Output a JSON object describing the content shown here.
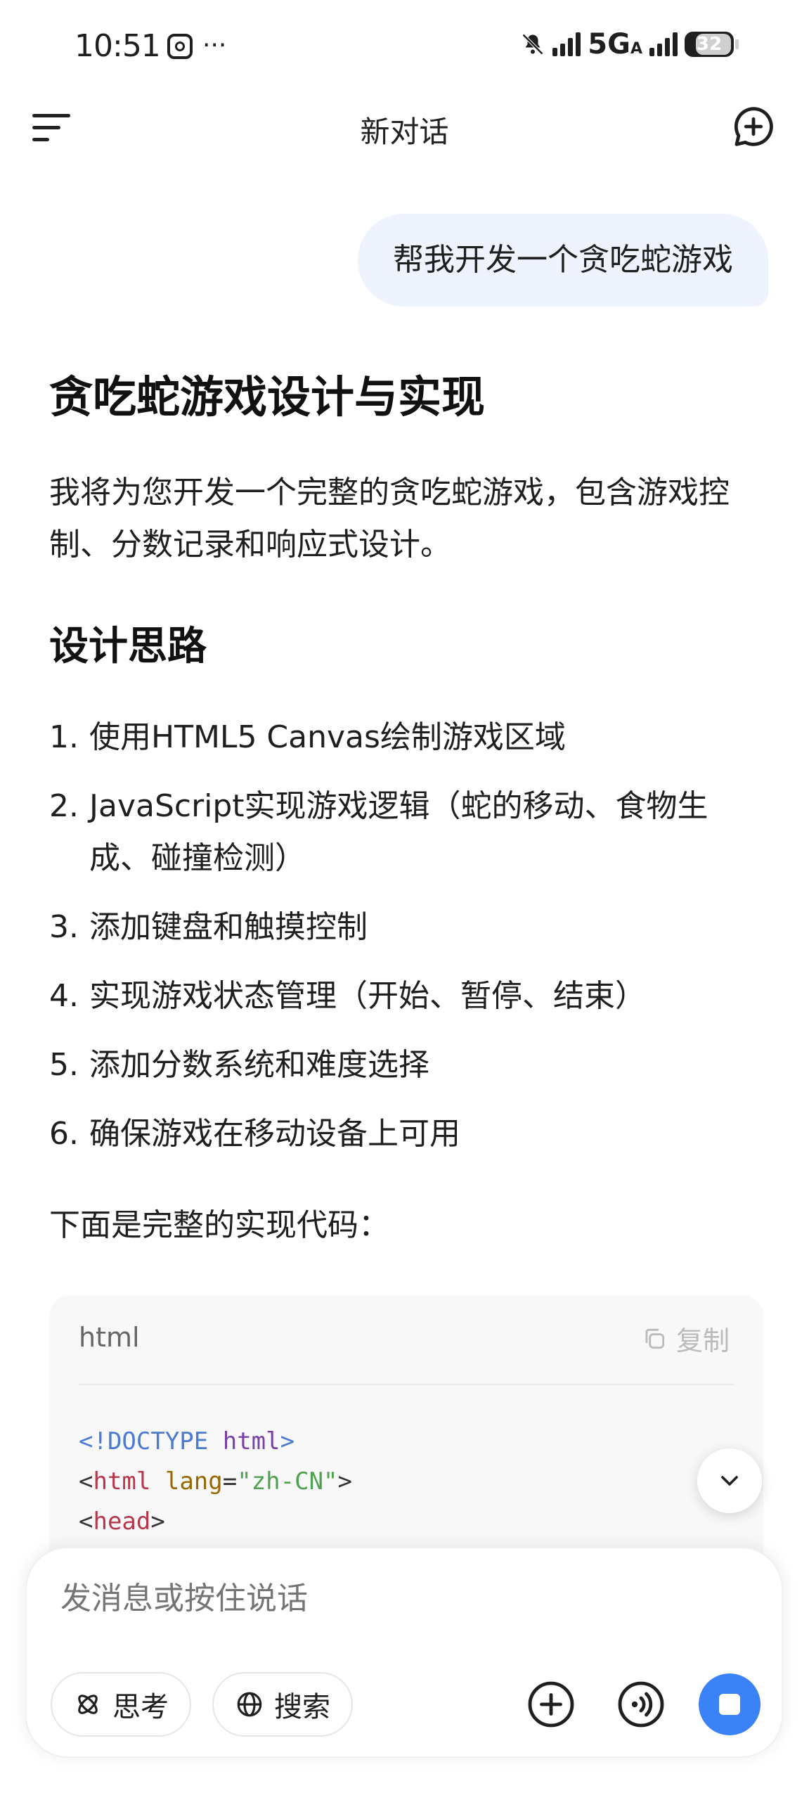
{
  "status_bar": {
    "time": "10:51",
    "more": "···",
    "network": "5G",
    "network_sub": "A",
    "battery": "32"
  },
  "header": {
    "title": "新对话"
  },
  "conversation": {
    "user_message": "帮我开发一个贪吃蛇游戏",
    "response": {
      "title": "贪吃蛇游戏设计与实现",
      "intro": "我将为您开发一个完整的贪吃蛇游戏，包含游戏控制、分数记录和响应式设计。",
      "section_title": "设计思路",
      "list": [
        {
          "num": "1.",
          "text": "使用HTML5 Canvas绘制游戏区域"
        },
        {
          "num": "2.",
          "text": "JavaScript实现游戏逻辑（蛇的移动、食物生成、碰撞检测）"
        },
        {
          "num": "3.",
          "text": "添加键盘和触摸控制"
        },
        {
          "num": "4.",
          "text": "实现游戏状态管理（开始、暂停、结束）"
        },
        {
          "num": "5.",
          "text": "添加分数系统和难度选择"
        },
        {
          "num": "6.",
          "text": "确保游戏在移动设备上可用"
        }
      ],
      "code_intro": "下面是完整的实现代码：",
      "code_block": {
        "language": "html",
        "copy_label": "复制",
        "lines": {
          "l1_a": "<!DOCTYPE",
          "l1_b": "html",
          "l1_c": ">",
          "l2_a": "<",
          "l2_b": "html",
          "l2_c": "lang",
          "l2_d": "=",
          "l2_e": "\"zh-CN\"",
          "l2_f": ">",
          "l3_a": "<",
          "l3_b": "head",
          "l3_c": ">"
        }
      }
    }
  },
  "composer": {
    "placeholder": "发消息或按住说话",
    "think_label": "思考",
    "search_label": "搜索"
  },
  "colors": {
    "accent": "#3b82f6",
    "user_bubble": "#eef3fe",
    "code_bg": "#f8f8f9"
  },
  "icons": [
    "app-notification-icon",
    "mute-icon",
    "signal-icon",
    "battery-icon",
    "menu-icon",
    "new-chat-icon",
    "copy-icon",
    "chevron-down-icon",
    "think-icon",
    "globe-icon",
    "plus-icon",
    "voice-call-icon",
    "stop-icon"
  ]
}
